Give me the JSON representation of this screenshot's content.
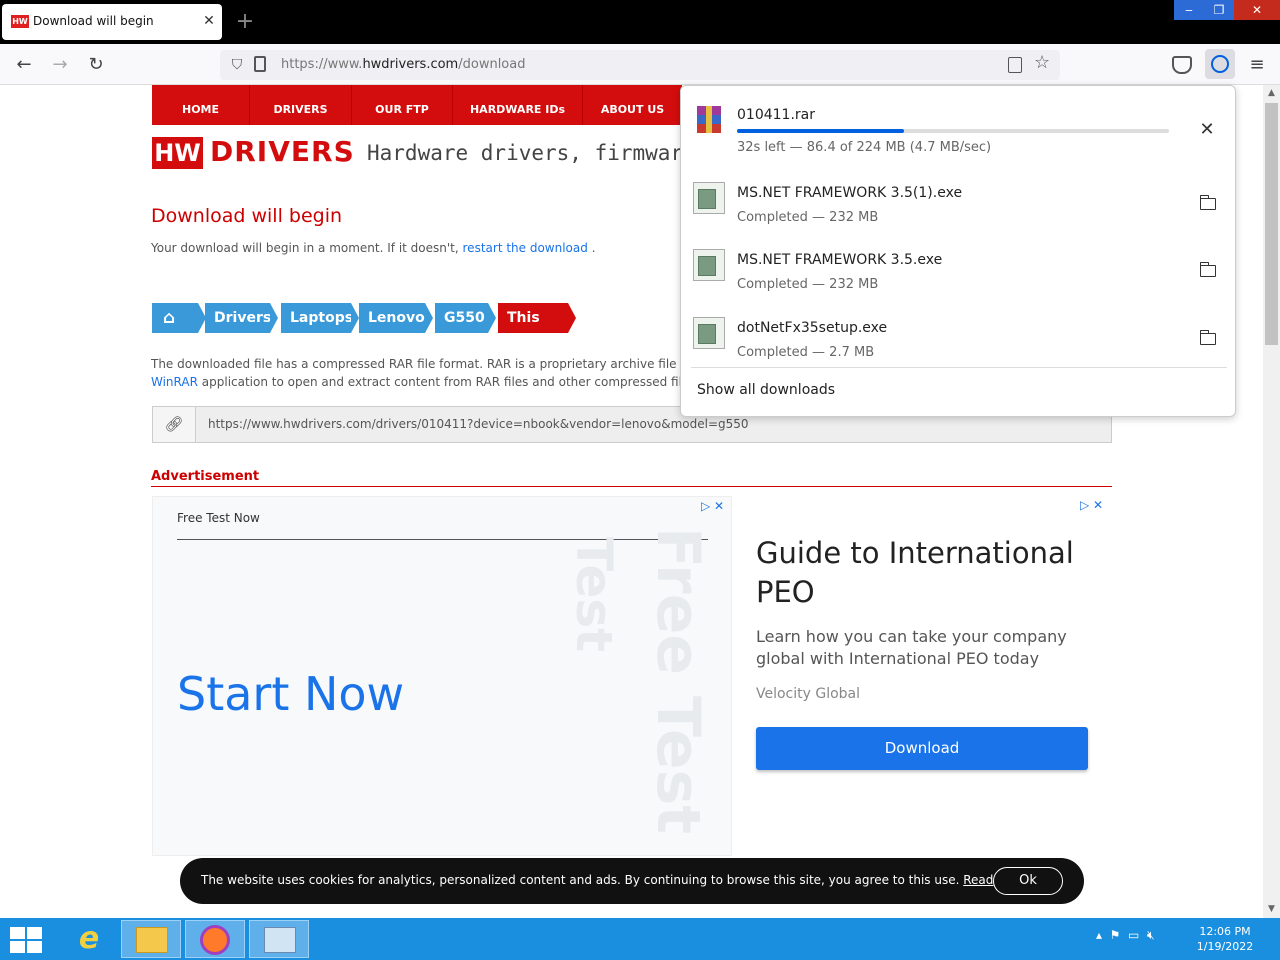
{
  "browser": {
    "tab_title": "Download will begin",
    "tab_favicon": "HW",
    "url_prefix": "https://www.",
    "url_domain": "hwdrivers.com",
    "url_path": "/download",
    "window_controls": {
      "minimize": "‒",
      "maximize": "❐",
      "close": "✕"
    }
  },
  "site": {
    "nav": [
      "HOME",
      "DRIVERS",
      "OUR FTP",
      "HARDWARE IDs",
      "ABOUT US"
    ],
    "logo_hw": "HW",
    "logo_drivers": "DRIVERS",
    "tagline": "Hardware drivers, firmware",
    "heading": "Download will begin",
    "sub_text": "Your download will begin in a moment. If it doesn't,",
    "sub_link": "restart the download",
    "sub_end": ".",
    "breadcrumbs": [
      "Drivers",
      "Laptops",
      "Lenovo",
      "G550",
      "This File"
    ],
    "desc_line1": "The downloaded file has a compressed RAR file format. RAR is a proprietary archive file format t",
    "desc_link": "WinRAR",
    "desc_line2": " application to open and extract content from RAR files and other compressed file format",
    "download_link": "https://www.hwdrivers.com/drivers/010411?device=nbook&vendor=lenovo&model=g550",
    "ad_label": "Advertisement"
  },
  "ad1": {
    "free_test": "Free Test Now",
    "start_now": "Start Now",
    "ghost1": "Free Test",
    "ghost2": "Test"
  },
  "ad2": {
    "headline": "Guide to International PEO",
    "body": "Learn how you can take your company global with International PEO today",
    "source": "Velocity Global",
    "button": "Download"
  },
  "cookie": {
    "text": "The website uses cookies for analytics, personalized content and ads. By continuing to browse this site, you agree to this use.",
    "read": "Read",
    "ok": "Ok"
  },
  "downloads": {
    "items": [
      {
        "name": "010411.rar",
        "status": "32s left — 86.4 of 224 MB (4.7 MB/sec)",
        "progress": 0.386,
        "icon": "winrar-icon"
      },
      {
        "name": "MS.NET FRAMEWORK 3.5(1).exe",
        "status": "Completed — 232 MB",
        "icon": "exe-icon"
      },
      {
        "name": "MS.NET FRAMEWORK 3.5.exe",
        "status": "Completed — 232 MB",
        "icon": "exe-icon"
      },
      {
        "name": "dotNetFx35setup.exe",
        "status": "Completed — 2.7 MB",
        "icon": "exe-icon"
      }
    ],
    "show_all": "Show all downloads"
  },
  "taskbar": {
    "time": "12:06 PM",
    "date": "1/19/2022"
  },
  "colors": {
    "brand_red": "#d30d0d",
    "crumb_blue": "#3a9ad9",
    "link_blue": "#1a73e8",
    "taskbar": "#1a8fe0"
  }
}
